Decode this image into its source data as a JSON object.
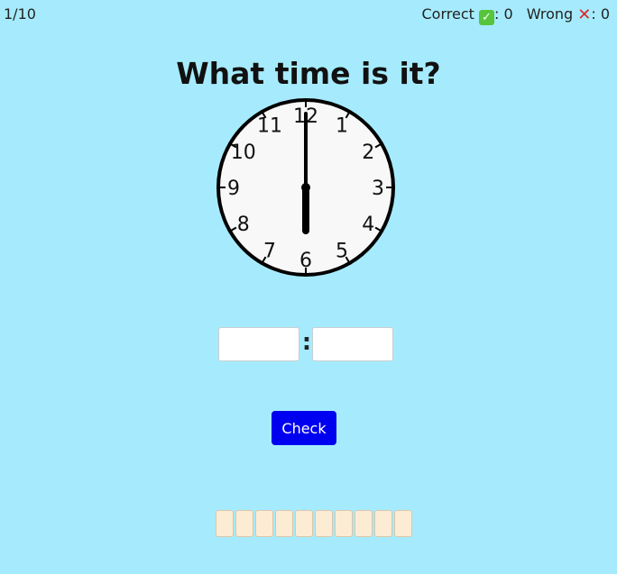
{
  "progress": "1/10",
  "score": {
    "correct_label": "Correct",
    "correct_value": ": 0",
    "wrong_label": "Wrong",
    "wrong_value": ": 0",
    "correct_icon": "check-mark-icon",
    "wrong_icon": "cross-mark-icon"
  },
  "title": "What time is it?",
  "clock": {
    "numbers": [
      "12",
      "1",
      "2",
      "3",
      "4",
      "5",
      "6",
      "7",
      "8",
      "9",
      "10",
      "11"
    ],
    "hour": 6,
    "minute": 0
  },
  "answer": {
    "hours_value": "",
    "minutes_value": "",
    "separator": ":"
  },
  "check_button": "Check",
  "progress_slots": 10,
  "colors": {
    "background": "#a6ebfd",
    "button": "#0000f0",
    "slot": "#fdecd4"
  }
}
